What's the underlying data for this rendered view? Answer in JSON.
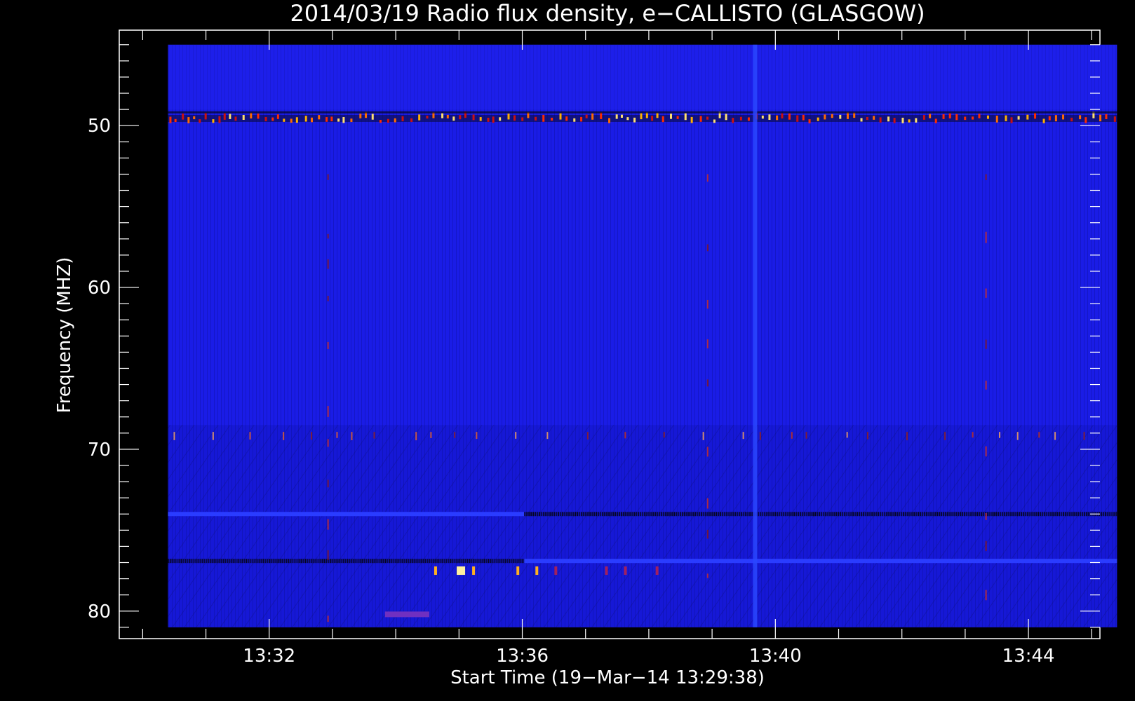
{
  "chart_data": {
    "type": "heatmap",
    "title": "2014/03/19  Radio flux density, e−CALLISTO (GLASGOW)",
    "xlabel": "Start Time (19−Mar−14 13:29:38)",
    "ylabel": "Frequency (MHZ)",
    "x_ticks": [
      "13:32",
      "13:36",
      "13:40",
      "13:44"
    ],
    "y_ticks": [
      "50",
      "60",
      "70",
      "80"
    ],
    "x_range_minutes": [
      0,
      15.5
    ],
    "x_tick_minutes": [
      2.37,
      6.37,
      10.37,
      14.37
    ],
    "y_range_mhz": [
      44.1,
      81.7
    ],
    "y_axis_inverted": true,
    "x_minor_step_minutes": 1,
    "y_minor_step_mhz": 1,
    "data_extent": {
      "x_minutes": [
        0.77,
        15.77
      ],
      "y_mhz": [
        45.0,
        81.0
      ]
    },
    "colormap": "blue-to-red-to-yellow (IDL color table 'Blue/Red/Yellow')",
    "background_intensity_color": "#1a1ce6",
    "features": [
      {
        "kind": "horizontal_interference_band",
        "freq_mhz": 49.6,
        "intensity": "high",
        "note": "dashed row of red/orange/yellow pulses across full time span"
      },
      {
        "kind": "dark_gap",
        "freq_mhz": 49.2
      },
      {
        "kind": "horizontal_band",
        "freq_mhz": 74.0,
        "time_range_minutes": [
          0.77,
          6.4
        ],
        "color": "#2a3cff"
      },
      {
        "kind": "horizontal_band_dark",
        "freq_mhz": 74.0,
        "time_range_minutes": [
          6.4,
          15.77
        ]
      },
      {
        "kind": "horizontal_band_dark",
        "freq_mhz": 76.9,
        "time_range_minutes": [
          0.77,
          6.4
        ]
      },
      {
        "kind": "horizontal_band",
        "freq_mhz": 76.9,
        "time_range_minutes": [
          6.4,
          15.77
        ],
        "color": "#2a3cff"
      },
      {
        "kind": "vertical_line",
        "time_minutes": 10.05,
        "color": "#2a48ff",
        "note": "broadband vertical stripe"
      },
      {
        "kind": "row_of_dots",
        "freq_mhz": 69.1,
        "intensity": "medium"
      },
      {
        "kind": "bright_spots",
        "freq_mhz": 77.5,
        "time_minutes": [
          5.0,
          5.4,
          5.6,
          6.3,
          6.6,
          6.9,
          7.7,
          8.0,
          8.5
        ]
      },
      {
        "kind": "short_band",
        "freq_mhz": 80.2,
        "time_range_minutes": [
          4.2,
          4.9
        ],
        "color": "#7030c0"
      },
      {
        "kind": "vertical_spikes",
        "time_minutes": [
          3.3,
          9.3,
          13.7
        ],
        "freq_range_mhz": [
          53,
          81
        ]
      }
    ]
  }
}
